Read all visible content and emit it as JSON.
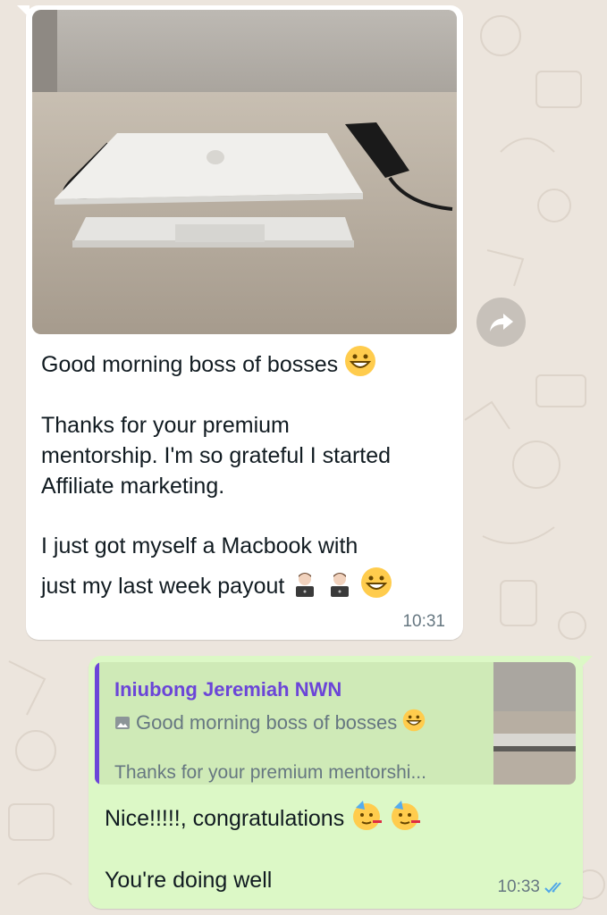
{
  "incoming_message": {
    "image_alt": "MacBook on table",
    "line_greeting": "Good morning boss of bosses",
    "paragraph_2_line_1": "Thanks for your premium",
    "paragraph_2_line_2": "mentorship. I'm so grateful I started",
    "paragraph_2_line_3": "Affiliate marketing.",
    "paragraph_3_line_1": "I just got myself a Macbook with",
    "paragraph_3_line_2": "just my last week payout",
    "time": "10:31"
  },
  "outgoing_message": {
    "quoted_author": "Iniubong Jeremiah NWN",
    "quoted_line_1": "Good morning boss of bosses",
    "quoted_line_2": "Thanks for your premium mentorshi...",
    "line_1": "Nice!!!!!, congratulations",
    "line_2": "You're doing well",
    "time": "10:33",
    "status": "read"
  },
  "colors": {
    "incoming_bubble": "#ffffff",
    "outgoing_bubble": "#dcf8c6",
    "quote_accent": "#6b45d8",
    "read_ticks": "#4fa6e8",
    "wallpaper": "#ece5dd"
  },
  "icons": {
    "forward": "forward-icon",
    "quoted_photo": "photo-icon",
    "read_receipt": "double-check-icon"
  }
}
